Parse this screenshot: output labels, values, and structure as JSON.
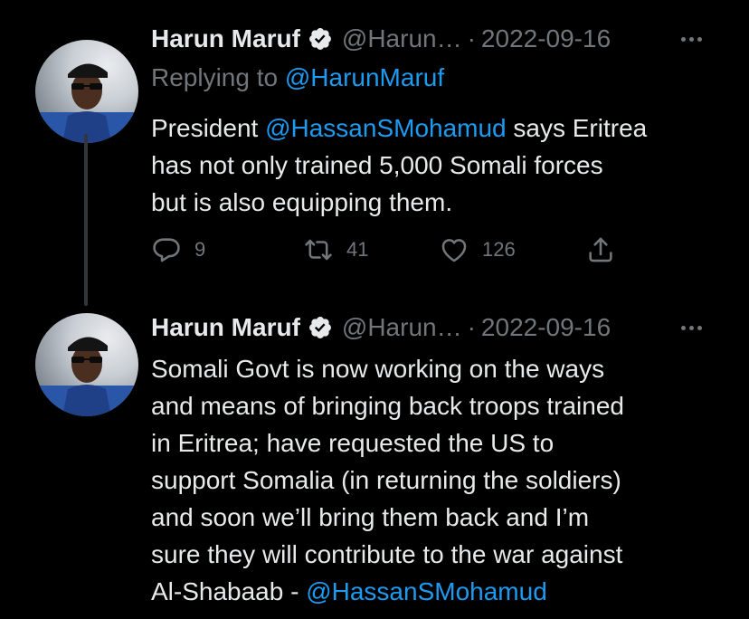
{
  "tweets": [
    {
      "author_name": "Harun Maruf",
      "handle": "@Harun…",
      "separator": "·",
      "date": "2022-09-16",
      "replying_prefix": "Replying to",
      "replying_handle": "@HarunMaruf",
      "lines": [
        [
          "President ",
          "@HassanSMohamud",
          " says Eritrea"
        ],
        "has not only trained 5,000 Somali forces",
        "but is also equipping them."
      ],
      "line1_prefix": "President ",
      "line1_mention": "@HassanSMohamud",
      "line1_suffix": " says Eritrea",
      "line2": "has not only trained 5,000 Somali forces",
      "line3": "but is also equipping them.",
      "replies": "9",
      "retweets": "41",
      "likes": "126"
    },
    {
      "author_name": "Harun Maruf",
      "handle": "@Harun…",
      "separator": "·",
      "date": "2022-09-16",
      "line1": "Somali Govt is now working on the ways",
      "line2": "and means of bringing back troops trained",
      "line3": "in Eritrea; have requested the US to",
      "line4": "support Somalia (in returning the soldiers)",
      "line5": "and soon we’ll bring them back and I’m",
      "line6": "sure they will contribute to the war against",
      "line7_prefix": "Al-Shabaab - ",
      "line7_mention": "@HassanSMohamud"
    }
  ],
  "colors": {
    "background": "#000000",
    "text": "#e7e9ea",
    "secondary": "#71767b",
    "link": "#1d9bf0",
    "thread_line": "#333639"
  },
  "icons": [
    "verified-badge-icon",
    "more-icon",
    "reply-icon",
    "retweet-icon",
    "like-icon",
    "share-icon"
  ]
}
